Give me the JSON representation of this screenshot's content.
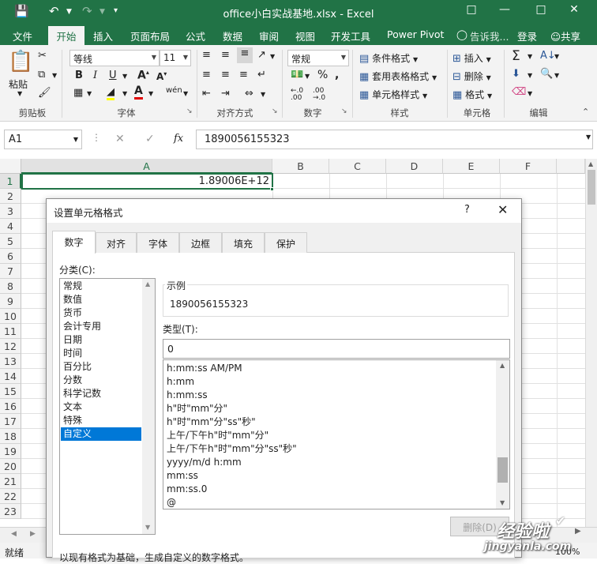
{
  "window": {
    "title": "office小白实战基地.xlsx - Excel"
  },
  "quick_access": {
    "save_icon": "save-icon",
    "undo_icon": "undo-icon",
    "redo_icon": "redo-icon"
  },
  "tabs": [
    "文件",
    "开始",
    "插入",
    "页面布局",
    "公式",
    "数据",
    "审阅",
    "视图",
    "开发工具",
    "Power Pivot"
  ],
  "tell_me": "告诉我...",
  "login": "登录",
  "share": "共享",
  "ribbon": {
    "paste": "粘贴",
    "clipboard": "剪贴板",
    "font_name": "等线",
    "font_size": "11",
    "font": "字体",
    "align": "对齐方式",
    "number_format": "常规",
    "number": "数字",
    "cond_format": "条件格式",
    "table_format": "套用表格格式",
    "cell_style": "单元格样式",
    "styles": "样式",
    "insert": "插入",
    "delete": "删除",
    "format": "格式",
    "cells": "单元格",
    "editing": "编辑"
  },
  "formula_bar": {
    "name_box": "A1",
    "fx": "fx",
    "value": "1890056155323"
  },
  "columns": [
    "A",
    "B",
    "C",
    "D",
    "E",
    "F"
  ],
  "rows": [
    "1",
    "2",
    "3",
    "4",
    "5",
    "6",
    "7",
    "8",
    "9",
    "10",
    "11",
    "12",
    "13",
    "14",
    "15",
    "16",
    "17",
    "18",
    "19",
    "20",
    "21",
    "22",
    "23"
  ],
  "cell_a1": "1.89006E+12",
  "status": {
    "ready": "就绪",
    "zoom": "100%"
  },
  "dialog": {
    "title": "设置单元格格式",
    "help": "?",
    "tabs": [
      "数字",
      "对齐",
      "字体",
      "边框",
      "填充",
      "保护"
    ],
    "category_label": "分类(C):",
    "categories": [
      "常规",
      "数值",
      "货币",
      "会计专用",
      "日期",
      "时间",
      "百分比",
      "分数",
      "科学记数",
      "文本",
      "特殊",
      "自定义"
    ],
    "sample_label": "示例",
    "sample_value": "1890056155323",
    "type_label": "类型(T):",
    "type_value": "0",
    "type_list": [
      "h:mm:ss AM/PM",
      "h:mm",
      "h:mm:ss",
      "h\"时\"mm\"分\"",
      "h\"时\"mm\"分\"ss\"秒\"",
      "上午/下午h\"时\"mm\"分\"",
      "上午/下午h\"时\"mm\"分\"ss\"秒\"",
      "yyyy/m/d h:mm",
      "mm:ss",
      "mm:ss.0",
      "@"
    ],
    "delete_button": "删除(D)",
    "footer_text": "以现有格式为基础，生成自定义的数字格式。"
  },
  "watermark": {
    "line1": "经验啦",
    "line2": "jingyanla.com"
  },
  "colors": {
    "excel_green": "#217346",
    "selected": "#0078d7"
  }
}
